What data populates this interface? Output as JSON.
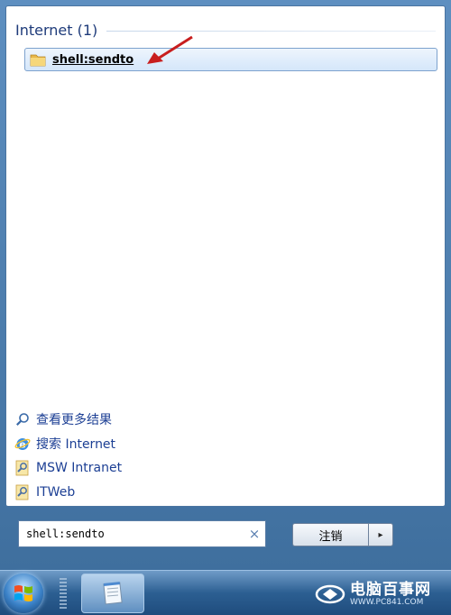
{
  "results": {
    "group_title": "Internet (1)",
    "items": [
      {
        "label": "shell:sendto",
        "icon": "folder-icon"
      }
    ]
  },
  "links": [
    {
      "label": "查看更多结果",
      "icon": "search-icon"
    },
    {
      "label": "搜索 Internet",
      "icon": "ie-icon"
    },
    {
      "label": "MSW Intranet",
      "icon": "web-shortcut-icon"
    },
    {
      "label": "ITWeb",
      "icon": "web-shortcut-icon"
    }
  ],
  "search": {
    "value": "shell:sendto",
    "clear_glyph": "×"
  },
  "power": {
    "logoff_label": "注销",
    "arrow_glyph": "▸"
  },
  "watermark": {
    "name": "电脑百事网",
    "url": "WWW.PC841.COM"
  },
  "colors": {
    "accent": "#1c3f94",
    "highlight": "#d4e6fa",
    "arrow": "#c81e1e"
  }
}
